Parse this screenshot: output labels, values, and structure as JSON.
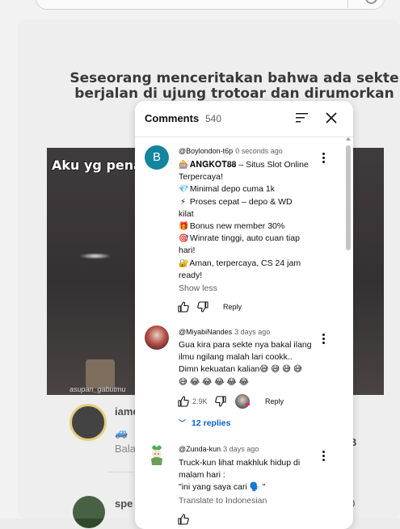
{
  "background": {
    "video_title": "Seseorang menceritakan bahwa ada sekte berjalan di ujung trotoar dan dirumorkan mereka",
    "video_caption": "Aku yg pena",
    "watermark": "asupan_gabutmu",
    "comment1_name": "iame",
    "comment1_line": "🚙",
    "comment1_line2": "Bala",
    "right_num1": "0",
    "right_num2": "B",
    "comment2_name": "spe",
    "right_num3": "0"
  },
  "panel": {
    "title": "Comments",
    "count": "540",
    "accent_link": "#065fd4",
    "comments": [
      {
        "avatar_letter": "B",
        "author": "@Boylondon-t6p",
        "time": "0 seconds ago",
        "lines": [
          {
            "emoji": "🎰",
            "text": "𝐀𝐍𝐆𝐊𝐎𝐓𝟖𝟖 – Situs Slot Online"
          },
          {
            "emoji": "",
            "text": "Terpercaya!"
          },
          {
            "emoji": "💎",
            "text": "Minimal depo cuma 1k"
          },
          {
            "emoji": "⚡",
            "text": "Proses cepat – depo & WD"
          },
          {
            "emoji": "",
            "text": "kilat"
          },
          {
            "emoji": "🎁",
            "text": "Bonus new member 30%"
          },
          {
            "emoji": "🎯",
            "text": "Winrate tinggi, auto cuan tiap"
          },
          {
            "emoji": "",
            "text": "hari!"
          },
          {
            "emoji": "🔐",
            "text": "Aman, terpercaya, CS 24 jam"
          },
          {
            "emoji": "",
            "text": "ready!"
          }
        ],
        "show_less": "Show less",
        "reply": "Reply"
      },
      {
        "author": "@MiyabiNandes",
        "time": "3 days ago",
        "lines": [
          "Gua kira para sekte nya bakal ilang",
          "ilmu ngilang malah lari cookk..",
          "Dimn kekuatan kalian😅 😅 😅 😅",
          "😅 😂 😂 😂 😂 😂"
        ],
        "likes": "2.9K",
        "reply": "Reply",
        "replies_label": "12 replies"
      },
      {
        "author": "@Zunda-kun",
        "time": "3 days ago",
        "lines": [
          "Truck-kun lihat makhluk hidup di",
          "malam hari :",
          "\"ini yang saya cari 🗣️ \""
        ],
        "translate": "Translate to Indonesian"
      }
    ]
  }
}
